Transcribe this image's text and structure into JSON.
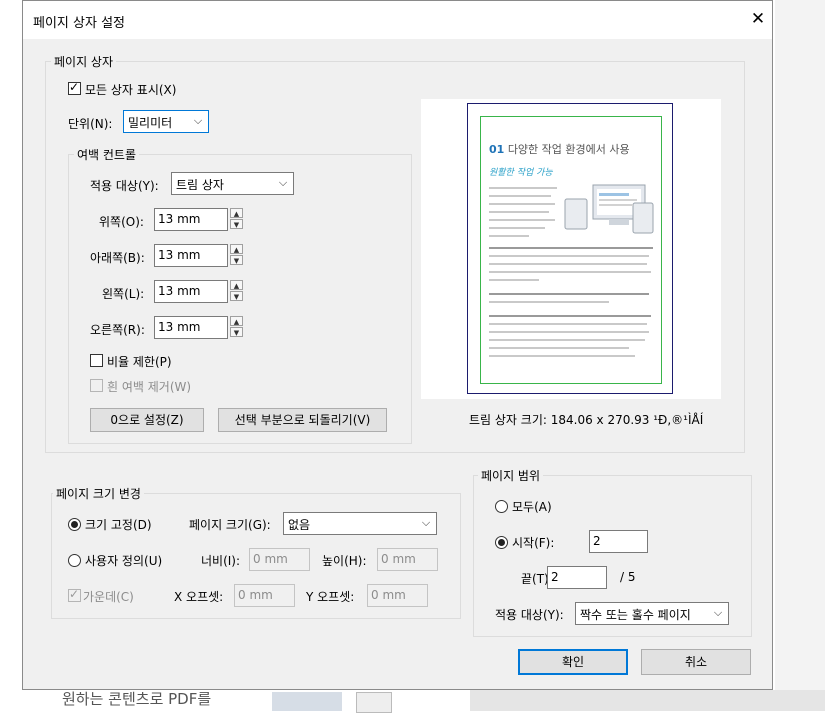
{
  "background": {
    "doc_text": "원하는 콘텐츠로 PDF를"
  },
  "dialog": {
    "title": "페이지 상자 설정",
    "close_glyph": "✕"
  },
  "page_boxes": {
    "group_label": "페이지 상자",
    "show_all": {
      "label": "모든 상자 표시(X)",
      "checked": true
    },
    "units": {
      "label": "단위(N):",
      "value": "밀리미터"
    },
    "margins": {
      "group_label": "여백 컨트롤",
      "apply_to": {
        "label": "적용 대상(Y):",
        "value": "트림 상자"
      },
      "top": {
        "label": "위쪽(O):",
        "value": "13 mm"
      },
      "bottom": {
        "label": "아래쪽(B):",
        "value": "13 mm"
      },
      "left": {
        "label": "왼쪽(L):",
        "value": "13 mm"
      },
      "right": {
        "label": "오른쪽(R):",
        "value": "13 mm"
      },
      "constrain": {
        "label": "비율 제한(P)",
        "checked": false
      },
      "remove_white": {
        "label": "흰 여백 제거(W)",
        "checked": false,
        "disabled": true
      },
      "set_zero_button": "0으로 설정(Z)",
      "revert_button": "선택 부분으로 되돌리기(V)"
    }
  },
  "preview": {
    "heading_number": "01",
    "heading_text": "다양한 작업 환경에서 사용",
    "subheading": "원활한 작업 가능",
    "trim_size_label": "트림 상자 크기: 184.06 x 270.93 ¹Ð,®¹ÌÅÍ"
  },
  "page_size": {
    "group_label": "페이지 크기 변경",
    "fixed": {
      "label": "크기 고정(D)",
      "selected": true
    },
    "page_size_combo": {
      "label": "페이지 크기(G):",
      "value": "없음"
    },
    "custom": {
      "label": "사용자 정의(U)",
      "selected": false
    },
    "width": {
      "label": "너비(I):",
      "value": "0 mm"
    },
    "height": {
      "label": "높이(H):",
      "value": "0 mm"
    },
    "center": {
      "label": "가운데(C)",
      "checked": true,
      "disabled": true
    },
    "x_offset": {
      "label": "X 오프셋:",
      "value": "0 mm"
    },
    "y_offset": {
      "label": "Y 오프셋:",
      "value": "0 mm"
    }
  },
  "page_range": {
    "group_label": "페이지 범위",
    "all": {
      "label": "모두(A)",
      "selected": false
    },
    "from": {
      "label": "시작(F):",
      "value": "2",
      "selected": true
    },
    "to": {
      "label": "끝(T):",
      "value": "2"
    },
    "total": "/ 5",
    "apply_to": {
      "label": "적용 대상(Y):",
      "value": "짝수 또는 홀수 페이지"
    }
  },
  "buttons": {
    "ok": "확인",
    "cancel": "취소"
  },
  "colors": {
    "dialog_bg": "#f0f0f0",
    "accent": "#0078d7",
    "trim_box": "#1c1c6e",
    "bleed_box": "#39b54a"
  }
}
